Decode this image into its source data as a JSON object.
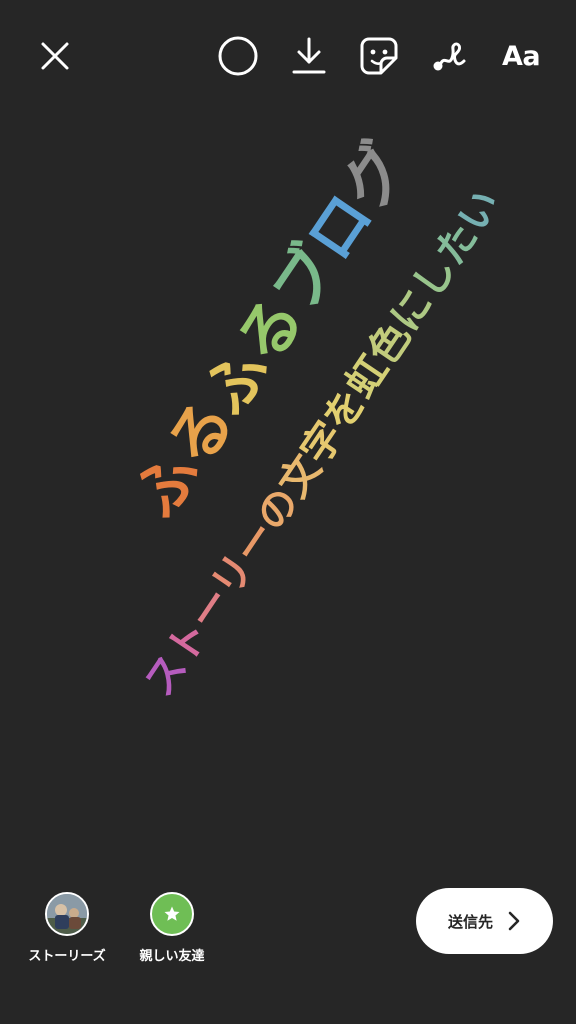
{
  "toolbar": {
    "close_icon": "close-icon",
    "circle_icon": "circle-icon",
    "download_icon": "download-icon",
    "sticker_icon": "sticker-icon",
    "draw_icon": "draw-icon",
    "text_tool_label": "Aa"
  },
  "story_text": {
    "line1": "ふるふるブログ",
    "line1_colors": [
      "#e47b3d",
      "#e8a24a",
      "#e3c45c",
      "#96c86b",
      "#79b98a",
      "#5aa0d6",
      "#8c8c8c"
    ],
    "line2": "ストーリーの文字を虹色にしたい",
    "line2_colors": [
      "#b65cbe",
      "#d4699e",
      "#df7d86",
      "#e58a72",
      "#e79866",
      "#e9a86a",
      "#e8b86e",
      "#e6c86f",
      "#e2d070",
      "#d4d076",
      "#c2cc7c",
      "#aec984",
      "#98c48c",
      "#84bc9a",
      "#76b0b2"
    ]
  },
  "bottom_bar": {
    "stories_label": "ストーリーズ",
    "close_friends_label": "親しい友達",
    "close_friends_color": "#6fbe55",
    "send_to_label": "送信先"
  },
  "colors": {
    "background": "#262626",
    "foreground": "#ffffff"
  }
}
